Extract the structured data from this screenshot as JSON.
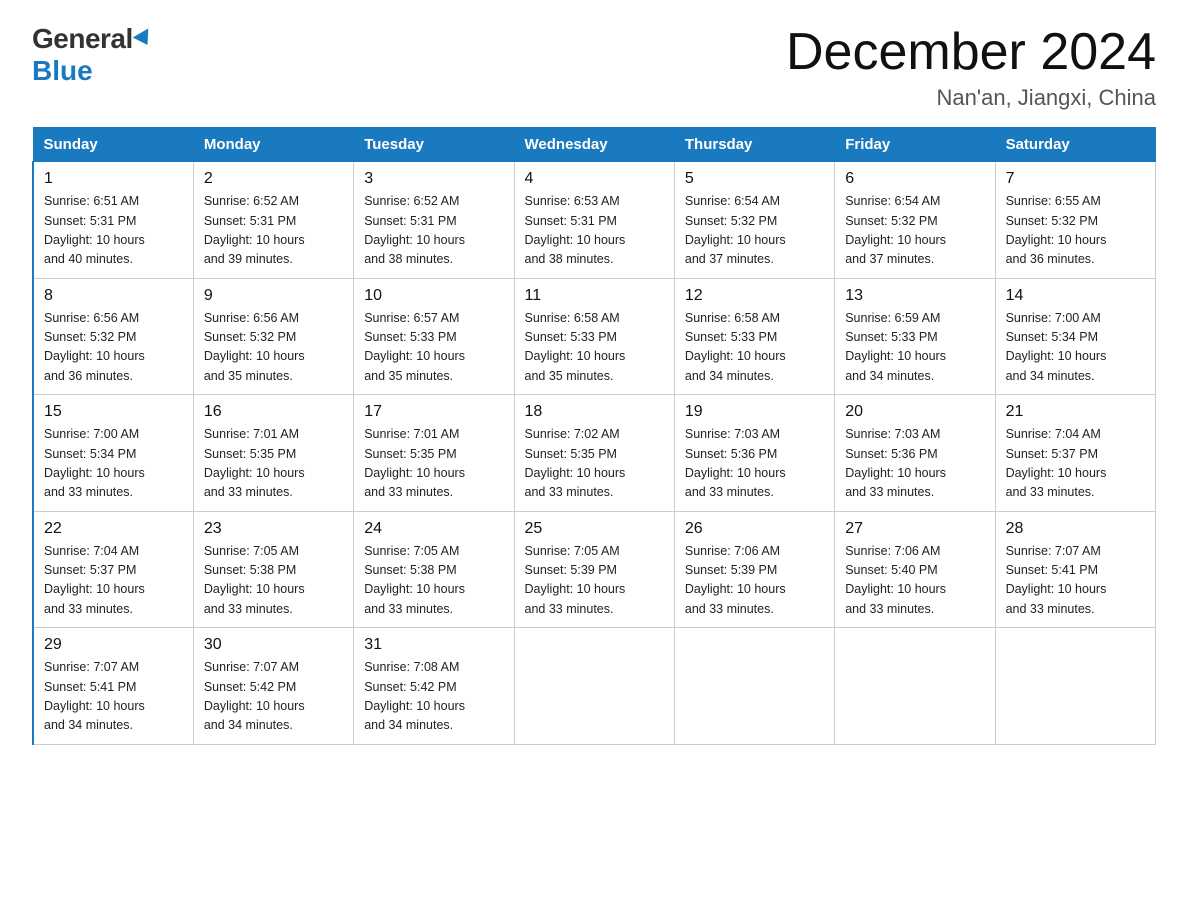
{
  "logo": {
    "general": "General",
    "blue": "Blue"
  },
  "header": {
    "month_year": "December 2024",
    "location": "Nan'an, Jiangxi, China"
  },
  "days_of_week": [
    "Sunday",
    "Monday",
    "Tuesday",
    "Wednesday",
    "Thursday",
    "Friday",
    "Saturday"
  ],
  "weeks": [
    [
      {
        "day": "1",
        "sunrise": "6:51 AM",
        "sunset": "5:31 PM",
        "daylight": "10 hours and 40 minutes."
      },
      {
        "day": "2",
        "sunrise": "6:52 AM",
        "sunset": "5:31 PM",
        "daylight": "10 hours and 39 minutes."
      },
      {
        "day": "3",
        "sunrise": "6:52 AM",
        "sunset": "5:31 PM",
        "daylight": "10 hours and 38 minutes."
      },
      {
        "day": "4",
        "sunrise": "6:53 AM",
        "sunset": "5:31 PM",
        "daylight": "10 hours and 38 minutes."
      },
      {
        "day": "5",
        "sunrise": "6:54 AM",
        "sunset": "5:32 PM",
        "daylight": "10 hours and 37 minutes."
      },
      {
        "day": "6",
        "sunrise": "6:54 AM",
        "sunset": "5:32 PM",
        "daylight": "10 hours and 37 minutes."
      },
      {
        "day": "7",
        "sunrise": "6:55 AM",
        "sunset": "5:32 PM",
        "daylight": "10 hours and 36 minutes."
      }
    ],
    [
      {
        "day": "8",
        "sunrise": "6:56 AM",
        "sunset": "5:32 PM",
        "daylight": "10 hours and 36 minutes."
      },
      {
        "day": "9",
        "sunrise": "6:56 AM",
        "sunset": "5:32 PM",
        "daylight": "10 hours and 35 minutes."
      },
      {
        "day": "10",
        "sunrise": "6:57 AM",
        "sunset": "5:33 PM",
        "daylight": "10 hours and 35 minutes."
      },
      {
        "day": "11",
        "sunrise": "6:58 AM",
        "sunset": "5:33 PM",
        "daylight": "10 hours and 35 minutes."
      },
      {
        "day": "12",
        "sunrise": "6:58 AM",
        "sunset": "5:33 PM",
        "daylight": "10 hours and 34 minutes."
      },
      {
        "day": "13",
        "sunrise": "6:59 AM",
        "sunset": "5:33 PM",
        "daylight": "10 hours and 34 minutes."
      },
      {
        "day": "14",
        "sunrise": "7:00 AM",
        "sunset": "5:34 PM",
        "daylight": "10 hours and 34 minutes."
      }
    ],
    [
      {
        "day": "15",
        "sunrise": "7:00 AM",
        "sunset": "5:34 PM",
        "daylight": "10 hours and 33 minutes."
      },
      {
        "day": "16",
        "sunrise": "7:01 AM",
        "sunset": "5:35 PM",
        "daylight": "10 hours and 33 minutes."
      },
      {
        "day": "17",
        "sunrise": "7:01 AM",
        "sunset": "5:35 PM",
        "daylight": "10 hours and 33 minutes."
      },
      {
        "day": "18",
        "sunrise": "7:02 AM",
        "sunset": "5:35 PM",
        "daylight": "10 hours and 33 minutes."
      },
      {
        "day": "19",
        "sunrise": "7:03 AM",
        "sunset": "5:36 PM",
        "daylight": "10 hours and 33 minutes."
      },
      {
        "day": "20",
        "sunrise": "7:03 AM",
        "sunset": "5:36 PM",
        "daylight": "10 hours and 33 minutes."
      },
      {
        "day": "21",
        "sunrise": "7:04 AM",
        "sunset": "5:37 PM",
        "daylight": "10 hours and 33 minutes."
      }
    ],
    [
      {
        "day": "22",
        "sunrise": "7:04 AM",
        "sunset": "5:37 PM",
        "daylight": "10 hours and 33 minutes."
      },
      {
        "day": "23",
        "sunrise": "7:05 AM",
        "sunset": "5:38 PM",
        "daylight": "10 hours and 33 minutes."
      },
      {
        "day": "24",
        "sunrise": "7:05 AM",
        "sunset": "5:38 PM",
        "daylight": "10 hours and 33 minutes."
      },
      {
        "day": "25",
        "sunrise": "7:05 AM",
        "sunset": "5:39 PM",
        "daylight": "10 hours and 33 minutes."
      },
      {
        "day": "26",
        "sunrise": "7:06 AM",
        "sunset": "5:39 PM",
        "daylight": "10 hours and 33 minutes."
      },
      {
        "day": "27",
        "sunrise": "7:06 AM",
        "sunset": "5:40 PM",
        "daylight": "10 hours and 33 minutes."
      },
      {
        "day": "28",
        "sunrise": "7:07 AM",
        "sunset": "5:41 PM",
        "daylight": "10 hours and 33 minutes."
      }
    ],
    [
      {
        "day": "29",
        "sunrise": "7:07 AM",
        "sunset": "5:41 PM",
        "daylight": "10 hours and 34 minutes."
      },
      {
        "day": "30",
        "sunrise": "7:07 AM",
        "sunset": "5:42 PM",
        "daylight": "10 hours and 34 minutes."
      },
      {
        "day": "31",
        "sunrise": "7:08 AM",
        "sunset": "5:42 PM",
        "daylight": "10 hours and 34 minutes."
      },
      null,
      null,
      null,
      null
    ]
  ],
  "labels": {
    "sunrise": "Sunrise:",
    "sunset": "Sunset:",
    "daylight": "Daylight:"
  }
}
